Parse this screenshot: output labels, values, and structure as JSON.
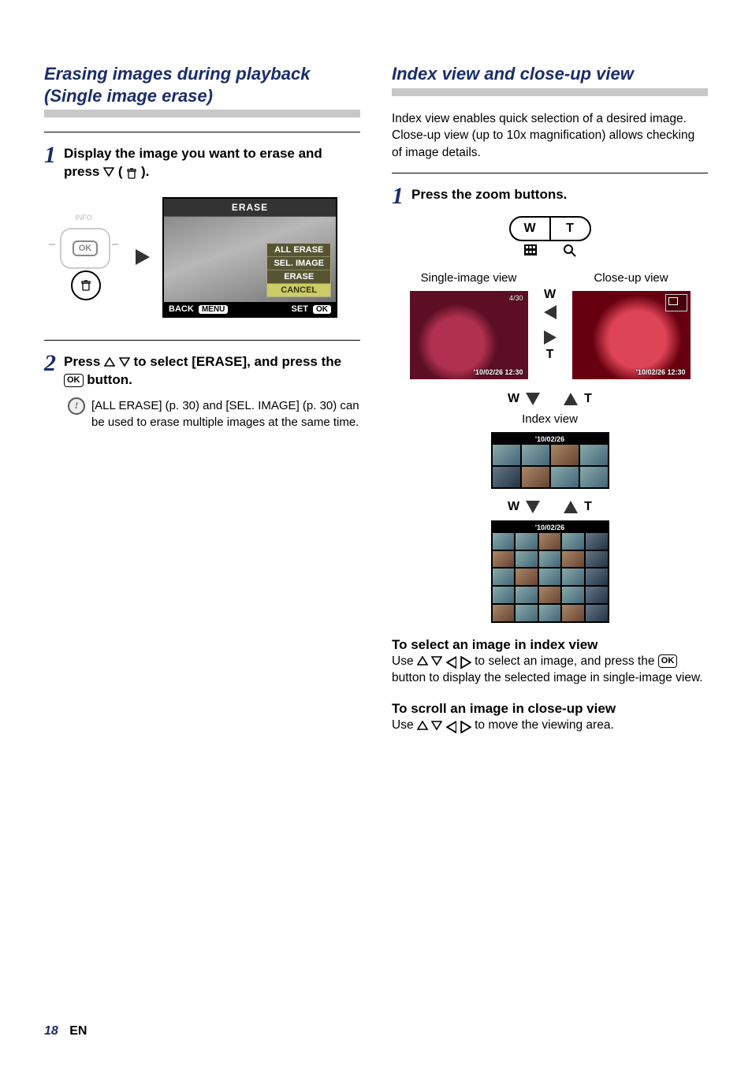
{
  "page": {
    "number": "18",
    "lang": "EN"
  },
  "left": {
    "title": "Erasing images during playback (Single image erase)",
    "step1": "Display the image you want to erase and press ",
    "step1_suffix": " (",
    "step1_close": ").",
    "dpad": {
      "info": "INFO",
      "ok": "OK"
    },
    "screen": {
      "title": "ERASE",
      "menu": [
        "ALL ERASE",
        "SEL. IMAGE",
        "ERASE",
        "CANCEL"
      ],
      "back": "BACK",
      "back_pill": "MENU",
      "set": "SET",
      "set_pill": "OK"
    },
    "step2_a": "Press ",
    "step2_b": " to select [ERASE], and press the ",
    "step2_c": " button.",
    "note": "[ALL ERASE] (p. 30) and [SEL. IMAGE] (p. 30) can be used to erase multiple images at the same time."
  },
  "right": {
    "title": "Index view and close-up view",
    "intro": "Index view enables quick selection of a desired image. Close-up view (up to 10x magnification) allows checking of image details.",
    "step1": "Press the zoom buttons.",
    "zoom": {
      "w": "W",
      "t": "T"
    },
    "labels": {
      "single": "Single-image view",
      "closeup": "Close-up view",
      "index": "Index view"
    },
    "thumb": {
      "counter": "4/30",
      "stamp": "'10/02/26 12:30",
      "date_short": "'10/02/26"
    },
    "sub1_h": "To select an image in index view",
    "sub1_a": "Use ",
    "sub1_b": " to select an image, and press the ",
    "sub1_c": " button to display the selected image in single-image view.",
    "sub2_h": "To scroll an image in close-up view",
    "sub2_a": "Use ",
    "sub2_b": " to move the viewing area."
  }
}
